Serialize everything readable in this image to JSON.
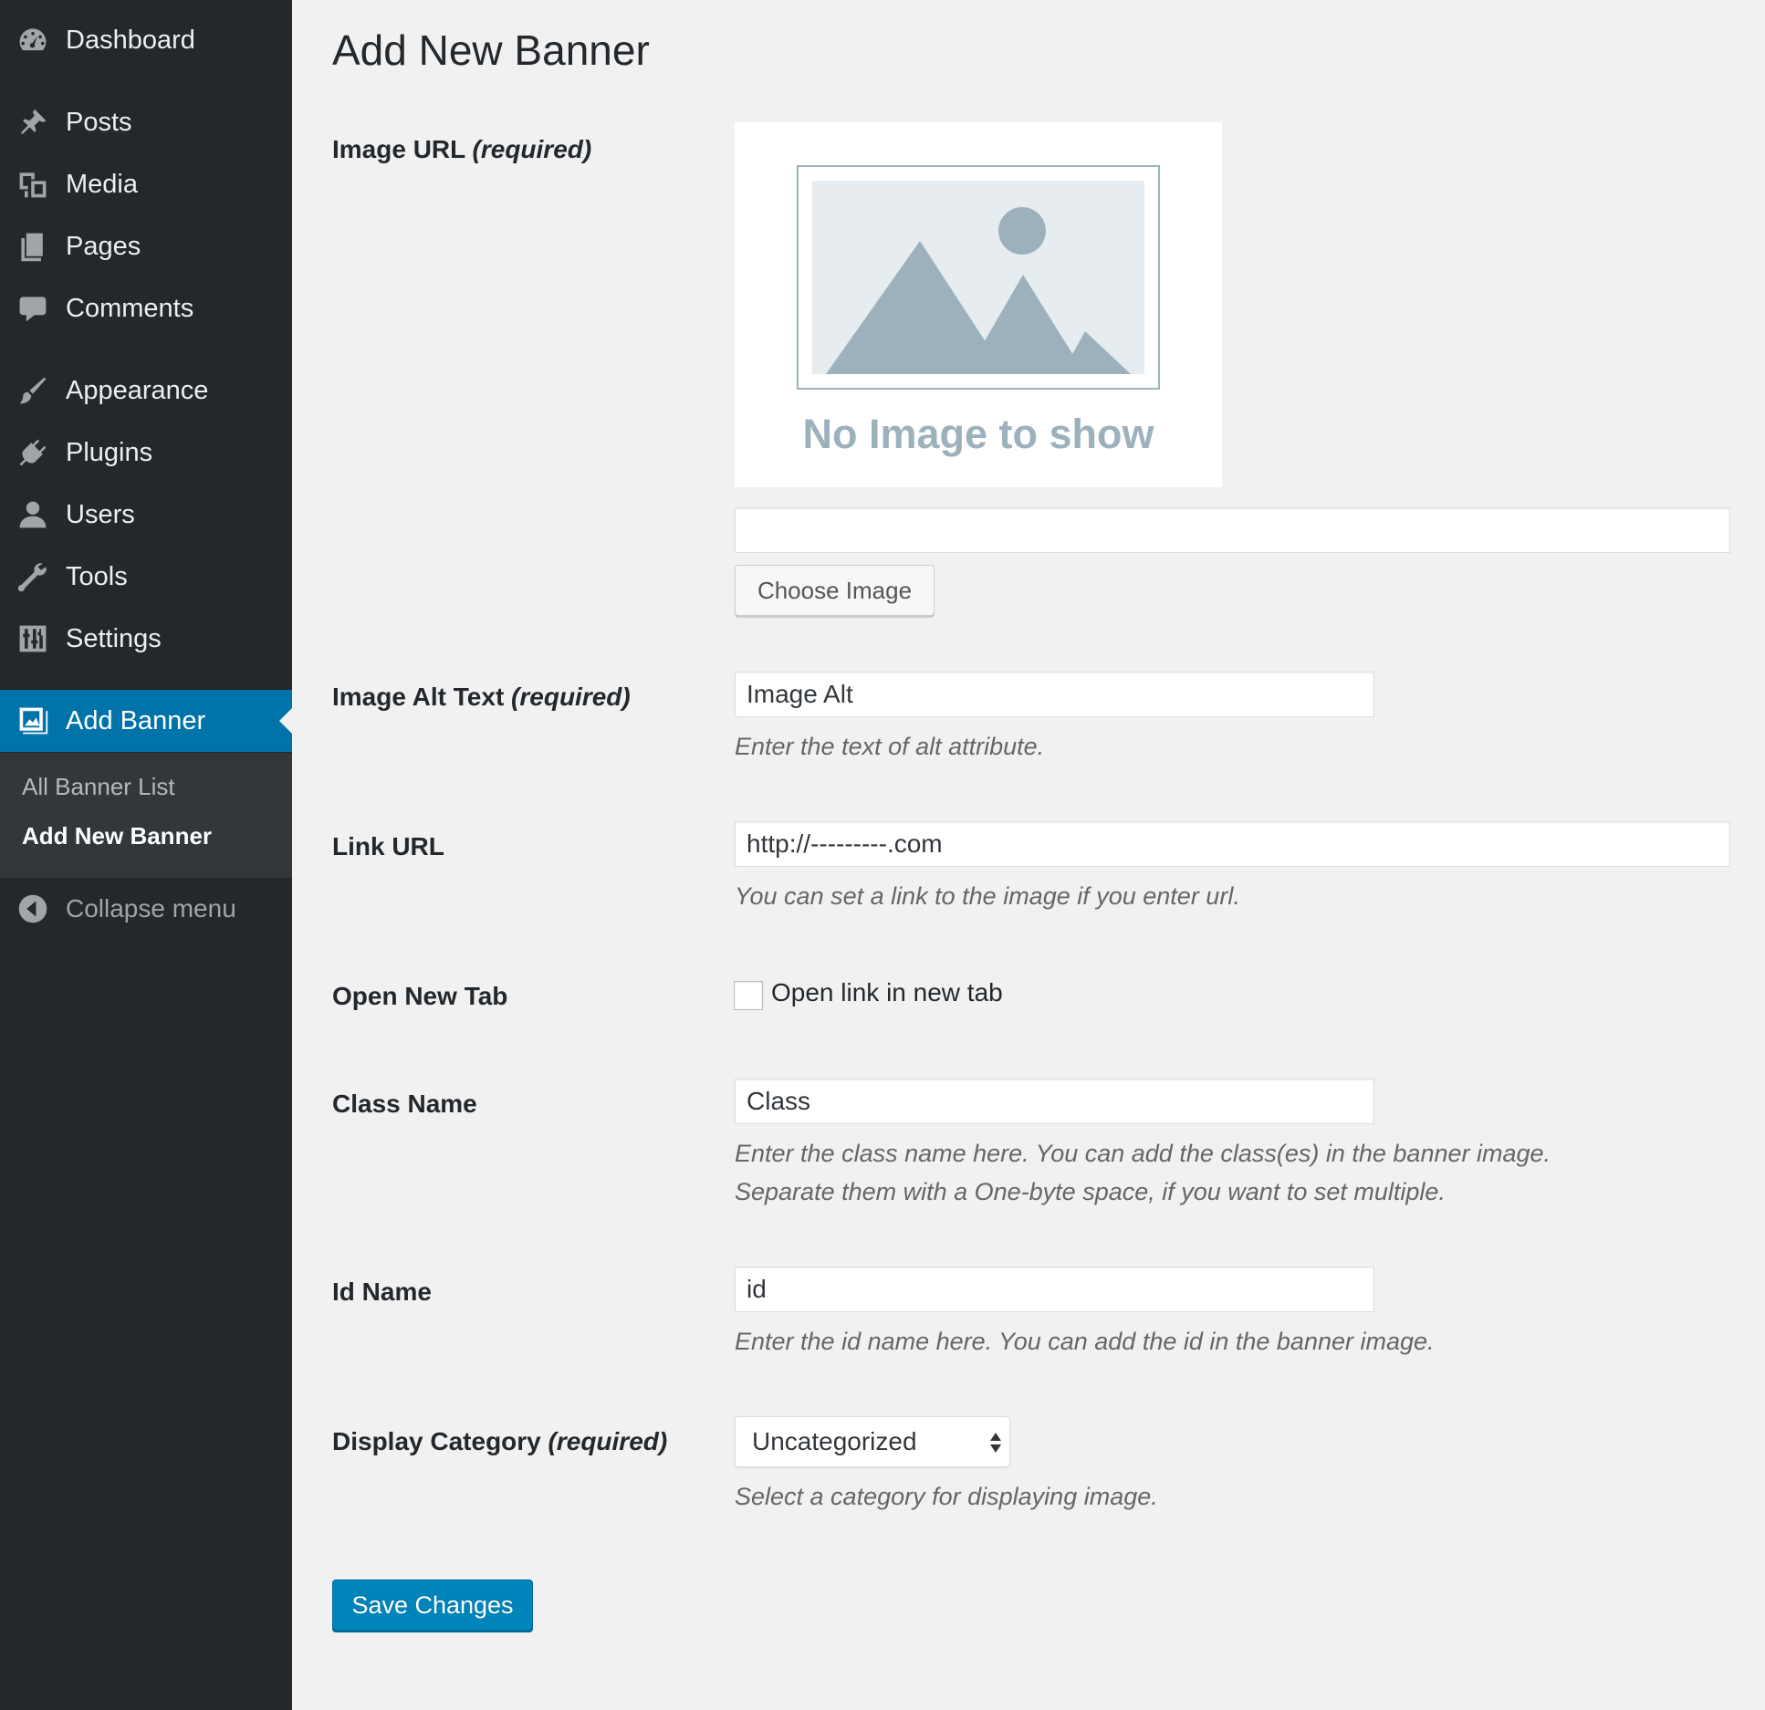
{
  "sidebar": {
    "items": [
      {
        "label": "Dashboard",
        "icon": "dashboard-icon"
      },
      {
        "label": "Posts",
        "icon": "pushpin-icon"
      },
      {
        "label": "Media",
        "icon": "media-icon"
      },
      {
        "label": "Pages",
        "icon": "pages-icon"
      },
      {
        "label": "Comments",
        "icon": "comment-icon"
      },
      {
        "label": "Appearance",
        "icon": "paintbrush-icon"
      },
      {
        "label": "Plugins",
        "icon": "plugin-icon"
      },
      {
        "label": "Users",
        "icon": "user-icon"
      },
      {
        "label": "Tools",
        "icon": "wrench-icon"
      },
      {
        "label": "Settings",
        "icon": "settings-icon"
      }
    ],
    "active": {
      "label": "Add Banner",
      "icon": "banner-icon"
    },
    "submenu": [
      {
        "label": "All Banner List"
      },
      {
        "label": "Add New Banner"
      }
    ],
    "collapse_label": "Collapse menu"
  },
  "page": {
    "title": "Add New Banner"
  },
  "form": {
    "image_url": {
      "label": "Image URL",
      "required": "(required)",
      "preview_text": "No Image to show",
      "value": "",
      "button": "Choose Image"
    },
    "alt_text": {
      "label": "Image Alt Text",
      "required": "(required)",
      "value": "Image Alt",
      "help": "Enter the text of alt attribute."
    },
    "link_url": {
      "label": "Link URL",
      "value": "http://---------.com",
      "help": "You can set a link to the image if you enter url."
    },
    "open_new_tab": {
      "label": "Open New Tab",
      "checkbox_label": "Open link in new tab",
      "checked": false
    },
    "class_name": {
      "label": "Class Name",
      "value": "Class",
      "help_line1": "Enter the class name here. You can add the class(es) in the banner image.",
      "help_line2": "Separate them with a One-byte space, if you want to set multiple."
    },
    "id_name": {
      "label": "Id Name",
      "value": "id",
      "help": "Enter the id name here. You can add the id in the banner image."
    },
    "display_category": {
      "label": "Display Category",
      "required": "(required)",
      "value": "Uncategorized",
      "help": "Select a category for displaying image."
    },
    "save_label": "Save Changes"
  },
  "colors": {
    "sidebar_bg": "#23282d",
    "accent": "#0073aa",
    "primary_button": "#0085ba",
    "placeholder_image": "#9db1bd"
  }
}
